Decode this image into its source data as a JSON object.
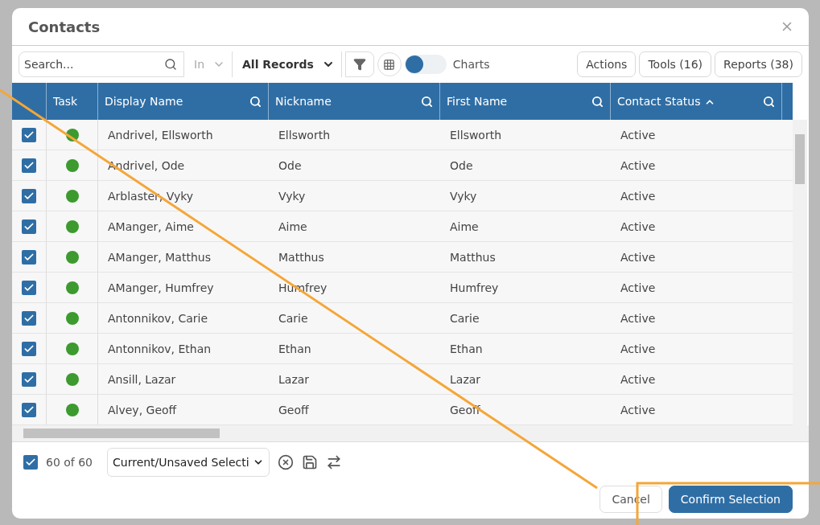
{
  "dialog": {
    "title": "Contacts"
  },
  "toolbar": {
    "search": {
      "placeholder": "Search..."
    },
    "scope": "In",
    "records": "All Records",
    "charts": {
      "label": "Charts",
      "on": false
    },
    "buttons": [
      "Actions",
      "Tools (16)",
      "Reports (38)"
    ]
  },
  "table": {
    "task_column": {
      "label": "Task"
    },
    "columns": [
      {
        "label": "Display Name",
        "searchable": true,
        "sorted": false
      },
      {
        "label": "Nickname",
        "searchable": true,
        "sorted": false
      },
      {
        "label": "First Name",
        "searchable": true,
        "sorted": false
      },
      {
        "label": "Contact Status",
        "searchable": true,
        "sorted": true
      }
    ],
    "rows": [
      {
        "checked": true,
        "color": "#3c9a2e",
        "cells": [
          "Andrivel, Ellsworth",
          "Ellsworth",
          "Ellsworth",
          "Active"
        ]
      },
      {
        "checked": true,
        "color": "#3c9a2e",
        "cells": [
          "Andrivel, Ode",
          "Ode",
          "Ode",
          "Active"
        ]
      },
      {
        "checked": true,
        "color": "#3c9a2e",
        "cells": [
          "Arblaster, Vyky",
          "Vyky",
          "Vyky",
          "Active"
        ]
      },
      {
        "checked": true,
        "color": "#3c9a2e",
        "cells": [
          "AManger, Aime",
          "Aime",
          "Aime",
          "Active"
        ]
      },
      {
        "checked": true,
        "color": "#3c9a2e",
        "cells": [
          "AManger, Matthus",
          "Matthus",
          "Matthus",
          "Active"
        ]
      },
      {
        "checked": true,
        "color": "#3c9a2e",
        "cells": [
          "AManger, Humfrey",
          "Humfrey",
          "Humfrey",
          "Active"
        ]
      },
      {
        "checked": true,
        "color": "#3c9a2e",
        "cells": [
          "Antonnikov, Carie",
          "Carie",
          "Carie",
          "Active"
        ]
      },
      {
        "checked": true,
        "color": "#3c9a2e",
        "cells": [
          "Antonnikov, Ethan",
          "Ethan",
          "Ethan",
          "Active"
        ]
      },
      {
        "checked": true,
        "color": "#3c9a2e",
        "cells": [
          "Ansill, Lazar",
          "Lazar",
          "Lazar",
          "Active"
        ]
      },
      {
        "checked": true,
        "color": "#3c9a2e",
        "cells": [
          "Alvey, Geoff",
          "Geoff",
          "Geoff",
          "Active"
        ]
      }
    ]
  },
  "footer": {
    "all_checked": true,
    "count": "60 of 60",
    "selection": "Current/Unsaved Selecti"
  },
  "buttons": [
    {
      "label": "Cancel",
      "kind": "secondary"
    },
    {
      "label": "Confirm Selection",
      "kind": "primary"
    }
  ]
}
